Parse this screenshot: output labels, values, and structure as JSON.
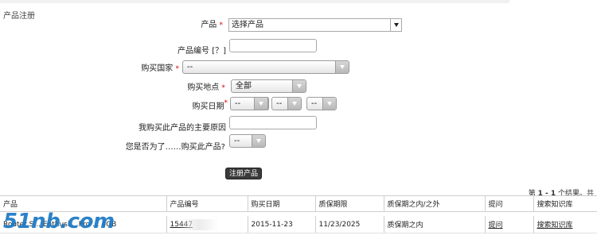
{
  "page": {
    "title": "产品注册"
  },
  "form": {
    "product": {
      "label": "产品",
      "value": "选择产品"
    },
    "product_number": {
      "label": "产品编号 [？]",
      "value": ""
    },
    "country": {
      "label": "购买国家",
      "value": "--"
    },
    "location": {
      "label": "购买地点",
      "value": "全部"
    },
    "date": {
      "label": "购买日期",
      "values": [
        "--",
        "--",
        "--"
      ]
    },
    "reason": {
      "label": "我购买此产品的主要原因",
      "value": ""
    },
    "purpose": {
      "label": "您是否为了……购买此产品?",
      "value": "--"
    },
    "required_mark": "*",
    "submit_label": "注册产品"
  },
  "results": {
    "prefix": "第 ",
    "range": "1 - 1",
    "suffix": " 个结果。共",
    "headers": [
      "产品",
      "产品编号",
      "购买日期",
      "质保期限",
      "质保期之内/之外",
      "提问",
      "搜索知识库"
    ],
    "rows": [
      {
        "product": "Router S... Enthusi... Pro ... 4GB",
        "number": "15447",
        "purchase_date": "2015-11-23",
        "warranty_until": "11/23/2025",
        "warranty_status": "质保期之内",
        "ask": "提问",
        "kb": "搜索知识库"
      }
    ]
  },
  "watermark": "51nb.com",
  "colors": {
    "required": "#d40000",
    "watermark": "#1a78c4",
    "button_bg": "#3a3a3a"
  }
}
